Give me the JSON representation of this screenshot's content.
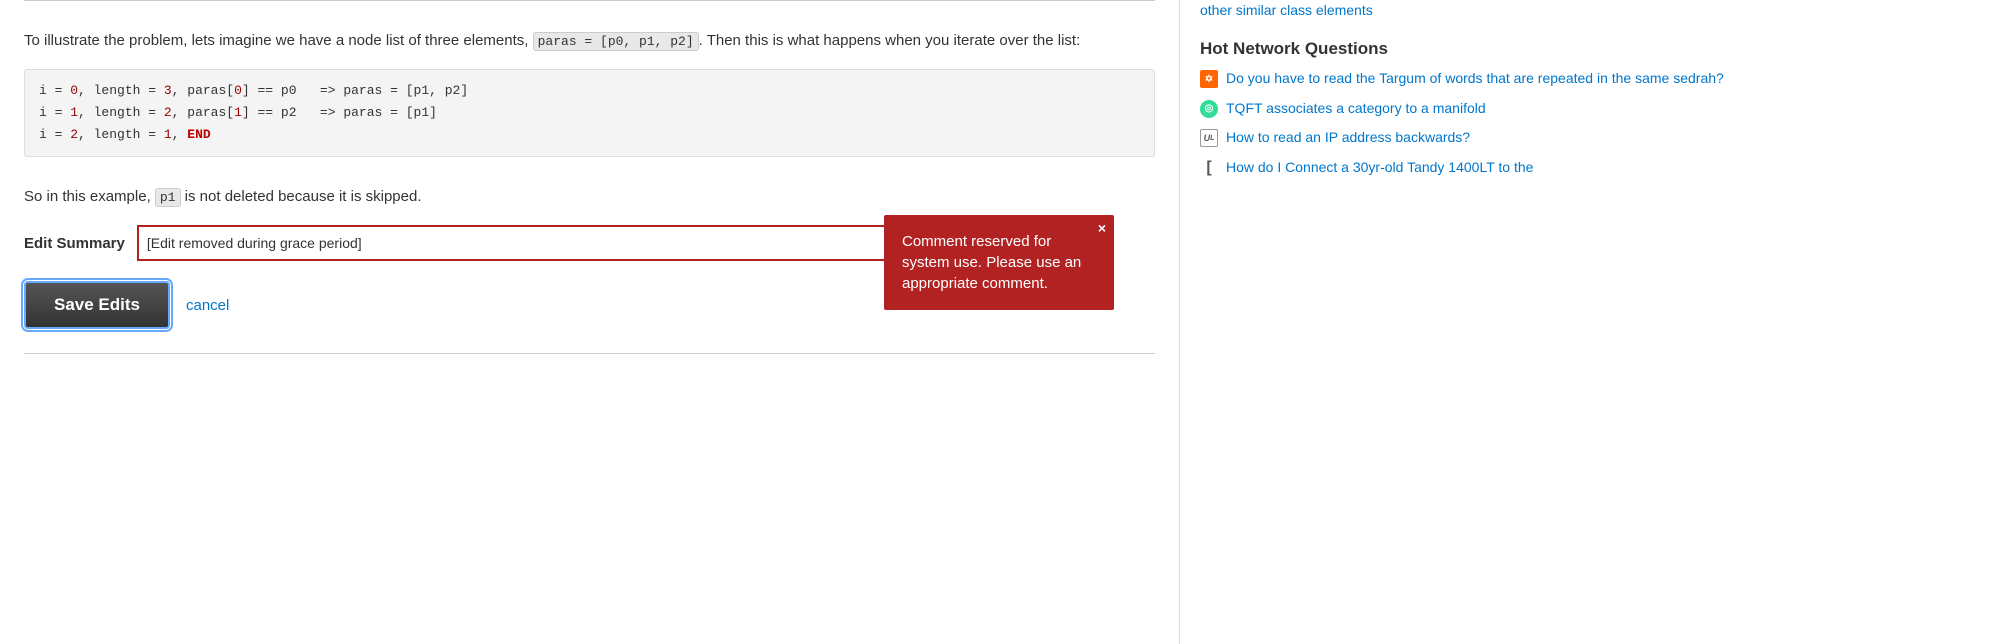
{
  "main": {
    "prose1": "To illustrate the problem, lets imagine we have a node list of three elements, ",
    "inline_code1": "paras = [p0, p1, p2]",
    "prose2": ". Then this is what happens when you iterate over the list:",
    "code_lines": [
      "i = 0, length = 3, paras[0] == p0   => paras = [p1, p2]",
      "i = 1, length = 2, paras[1] == p2   => paras = [p1]",
      "i = 2, length = 1, END"
    ],
    "prose3": "So in this example, ",
    "inline_code2": "p1",
    "prose4": " is not deleted because it is skipped.",
    "edit_summary_label": "Edit Summary",
    "edit_summary_value": "[Edit removed during grace period]",
    "tooltip_text": "Comment reserved for system use. Please use an appropriate comment.",
    "tooltip_close": "×",
    "save_button_label": "Save Edits",
    "cancel_label": "cancel"
  },
  "sidebar": {
    "similar_links": [
      "other similar class elements"
    ],
    "hot_network_title": "Hot Network Questions",
    "network_items": [
      {
        "icon_type": "orange",
        "icon_label": "J",
        "text": "Do you have to read the Targum of words that are repeated in the same sedrah?"
      },
      {
        "icon_type": "teal",
        "icon_label": "T",
        "text": "TQFT associates a category to a manifold"
      },
      {
        "icon_type": "ul",
        "icon_label": "UL",
        "text": "How to read an IP address backwards?"
      },
      {
        "icon_type": "arrow",
        "icon_label": "[",
        "text": "How do I Connect a 30yr-old Tandy 1400LT to the"
      }
    ]
  }
}
